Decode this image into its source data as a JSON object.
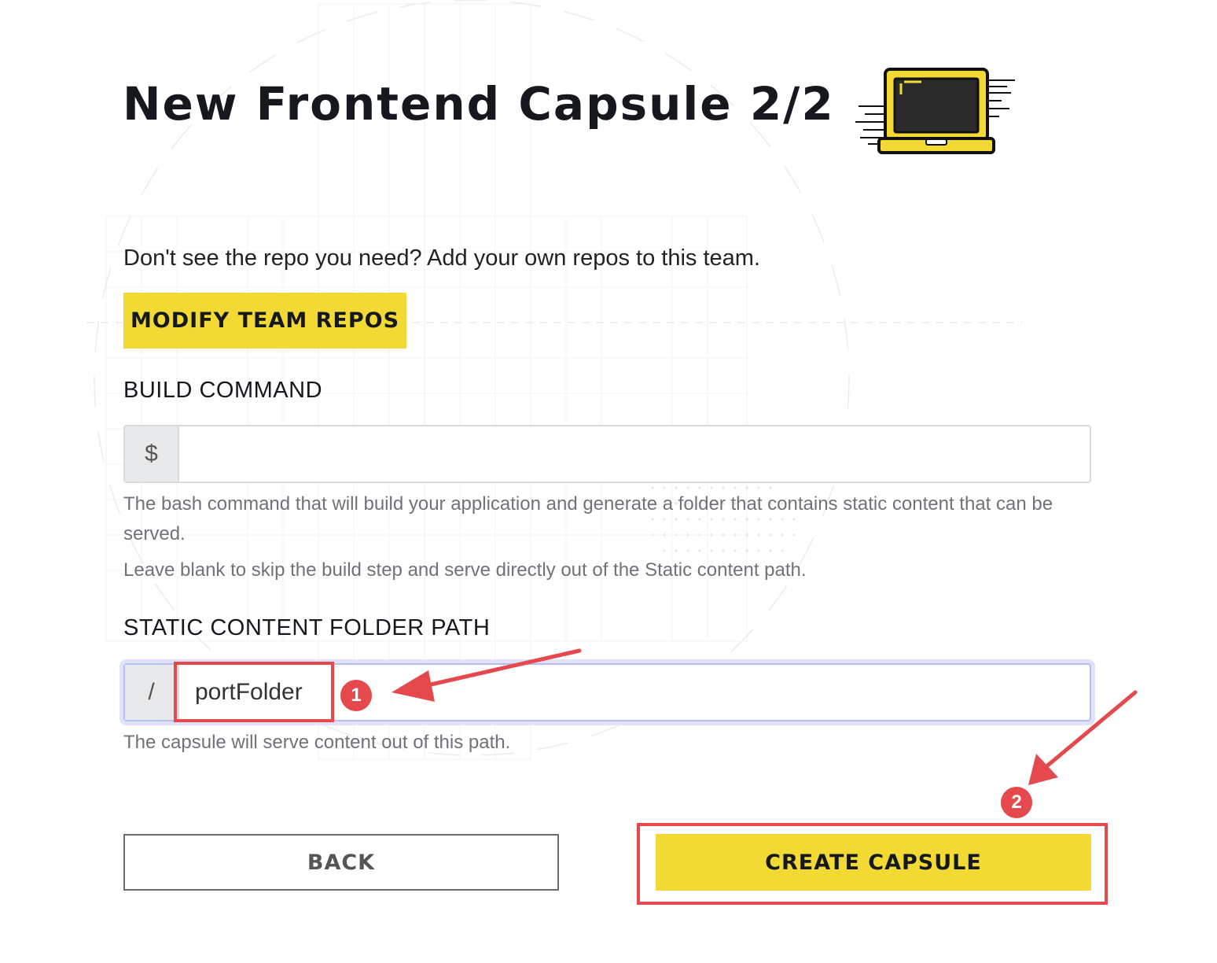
{
  "page": {
    "title": "New Frontend Capsule 2/2",
    "repo_hint": "Don't see the repo you need? Add your own repos to this team.",
    "modify_button": "MODIFY TEAM REPOS"
  },
  "build": {
    "label": "BUILD COMMAND",
    "prefix": "$",
    "value": "",
    "help_1": "The bash command that will build your application and generate a folder that contains static content that can be served.",
    "help_2": "Leave blank to skip the build step and serve directly out of the Static content path."
  },
  "static_path": {
    "label": "STATIC CONTENT FOLDER PATH",
    "prefix": "/",
    "value": "portFolder",
    "help": "The capsule will serve content out of this path."
  },
  "actions": {
    "back": "BACK",
    "create": "CREATE CAPSULE"
  },
  "annotations": {
    "badge_1": "1",
    "badge_2": "2"
  },
  "colors": {
    "accent_yellow": "#f2d934",
    "annotation_red": "#e5484d",
    "focus_blue": "#b9bdf6"
  },
  "icons": {
    "header_illustration": "laptop-icon"
  }
}
